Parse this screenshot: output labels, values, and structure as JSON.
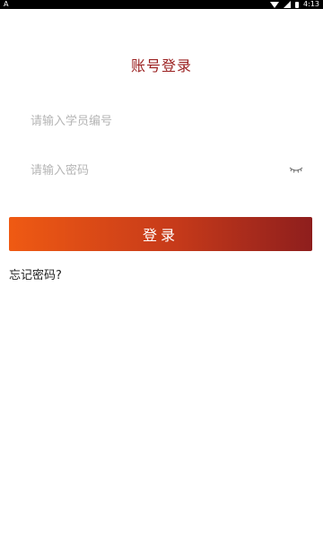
{
  "status_bar": {
    "left_label": "A",
    "time": "4:13",
    "icons": [
      "wifi-icon",
      "signal-icon",
      "battery-icon"
    ]
  },
  "login": {
    "title": "账号登录",
    "student_id_placeholder": "请输入学员编号",
    "password_placeholder": "请输入密码",
    "password_toggle_icon": "eye-closed-icon",
    "submit_label": "登录",
    "forgot_password_label": "忘记密码?"
  },
  "colors": {
    "title": "#9a1f1f",
    "button_gradient_start": "#ef5a13",
    "button_gradient_end": "#8e1e1d",
    "placeholder": "#b5b5b5"
  }
}
